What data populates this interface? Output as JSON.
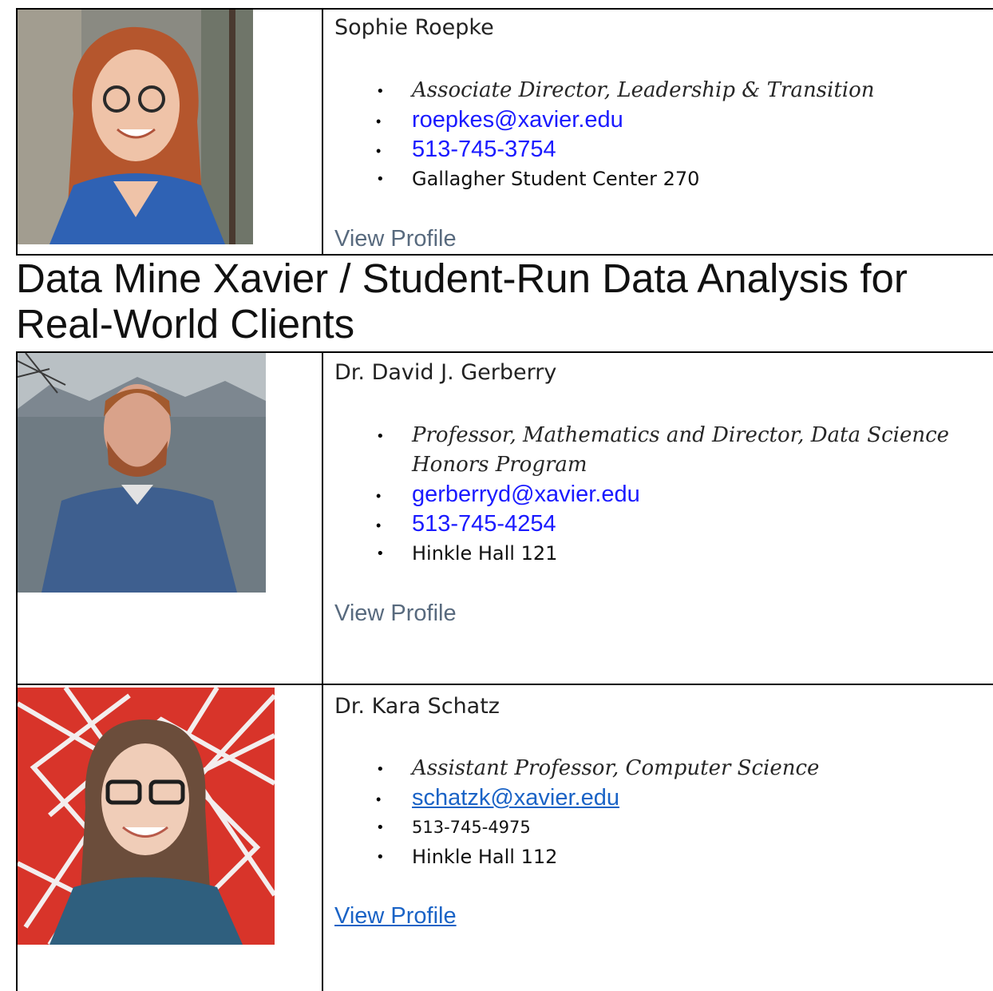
{
  "section_heading": "Data Mine Xavier / Student-Run Data Analysis for Real-World Clients",
  "people": [
    {
      "name": "Sophie Roepke",
      "title": "Associate Director, Leadership & Transition",
      "email": "roepkes@xavier.edu",
      "phone": "513-745-3754",
      "office": "Gallagher Student Center 270",
      "link": "View Profile"
    },
    {
      "name": "Dr. David J. Gerberry",
      "title_line1": "Professor, Mathematics and Director, Data Science",
      "title_line2": "Honors Program",
      "email": "gerberryd@xavier.edu",
      "phone": "513-745-4254",
      "office": "Hinkle Hall 121",
      "link": "View Profile"
    },
    {
      "name": "Dr. Kara Schatz",
      "title": "Assistant Professor, Computer Science",
      "email": "schatzk@xavier.edu",
      "phone": "513-745-4975",
      "office": "Hinkle Hall 112",
      "link": "View Profile"
    }
  ],
  "colors": {
    "link_blue": "#1a1aff",
    "link_underlined": "#1a63c6",
    "view_profile_gray": "#586a7e",
    "border": "#000000"
  }
}
